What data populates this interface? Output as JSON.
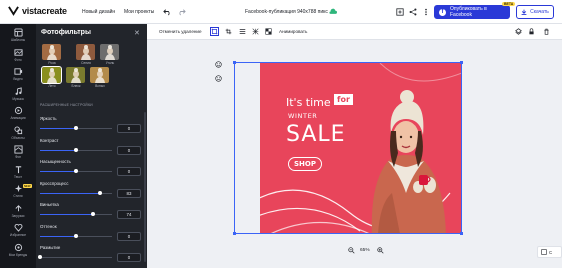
{
  "header": {
    "brand": "vistacreate",
    "new_design": "Новый дизайн",
    "my_projects": "Мои проекты",
    "doc_title": "Facebook-публикация 940х788 пикс",
    "publish_label": "Опубликовать в Facebook",
    "beta_badge": "BETA",
    "download_label": "Скачать"
  },
  "nav": [
    {
      "label": "Шаблоны",
      "icon": "templates-icon"
    },
    {
      "label": "Фото",
      "icon": "photo-icon"
    },
    {
      "label": "Видео",
      "icon": "video-icon"
    },
    {
      "label": "Музыка",
      "icon": "music-icon"
    },
    {
      "label": "Анимации",
      "icon": "animation-icon"
    },
    {
      "label": "Объекты",
      "icon": "objects-icon"
    },
    {
      "label": "Фон",
      "icon": "background-icon"
    },
    {
      "label": "Текст",
      "icon": "text-icon"
    },
    {
      "label": "Стили",
      "icon": "styles-icon",
      "badge": "NEW"
    },
    {
      "label": "Загрузки",
      "icon": "uploads-icon"
    },
    {
      "label": "Избранное",
      "icon": "favorites-icon"
    },
    {
      "label": "Мои бренды",
      "icon": "brand-icon"
    }
  ],
  "panel": {
    "title": "Фотофильтры",
    "filters": [
      {
        "label": "Роза",
        "tint": "#a36b43"
      },
      {
        "label": "Сепия",
        "tint": "#8e5a3d"
      },
      {
        "label": "Уголь",
        "tint": "#6d6d6d"
      },
      {
        "label": "Лето",
        "tint": "#8a8f1e",
        "selected": true
      },
      {
        "label": "Блеск",
        "tint": "#7a7a2e"
      },
      {
        "label": "Вспых",
        "tint": "#b38b4a"
      }
    ],
    "section_caption": "РАСШИРЕННЫЕ НАСТРОЙКИ",
    "sliders": [
      {
        "label": "Яркость",
        "value": "0",
        "level": 0.5
      },
      {
        "label": "Контраст",
        "value": "0",
        "level": 0.5
      },
      {
        "label": "Насыщенность",
        "value": "0",
        "level": 0.5
      },
      {
        "label": "Кросспроцесс",
        "value": "83",
        "level": 0.83
      },
      {
        "label": "Виньетка",
        "value": "74",
        "level": 0.74
      },
      {
        "label": "Оттенок",
        "value": "0",
        "level": 0.5
      },
      {
        "label": "Размытие",
        "value": "0",
        "level": 0.0
      }
    ]
  },
  "toolbar": {
    "remove_bg": "Отменить удаление",
    "animate": "Анимировать"
  },
  "canvas": {
    "zoom": "65%",
    "design_text": {
      "line1a": "It's time",
      "line1b": "for",
      "line2": "WINTER",
      "line3": "SALE",
      "shop": "SHOP"
    },
    "colors": {
      "background": "#e8455b",
      "accent": "#d9163a"
    }
  },
  "corner_button_label": "С"
}
